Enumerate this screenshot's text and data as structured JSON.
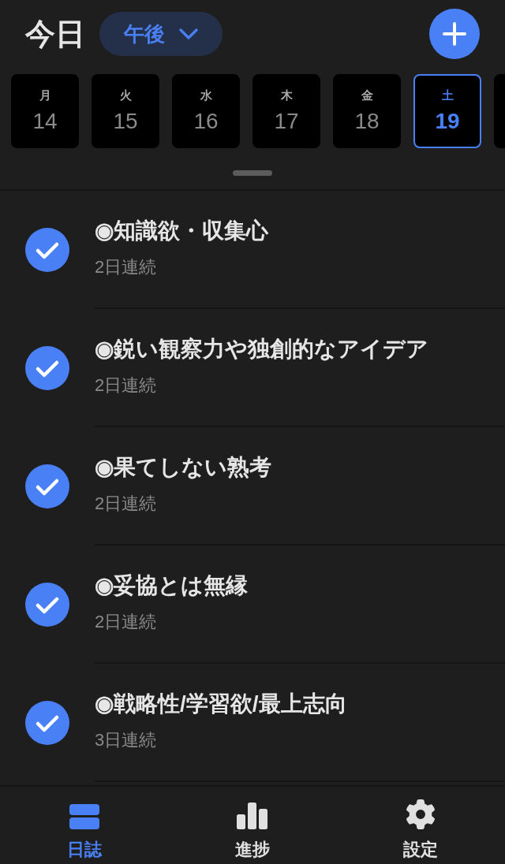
{
  "header": {
    "title": "今日",
    "period": {
      "label": "午後"
    }
  },
  "days": [
    {
      "weekday": "月",
      "date": "14",
      "selected": false
    },
    {
      "weekday": "火",
      "date": "15",
      "selected": false
    },
    {
      "weekday": "水",
      "date": "16",
      "selected": false
    },
    {
      "weekday": "木",
      "date": "17",
      "selected": false
    },
    {
      "weekday": "金",
      "date": "18",
      "selected": false
    },
    {
      "weekday": "土",
      "date": "19",
      "selected": true
    }
  ],
  "items": [
    {
      "title": "◉知識欲・収集心",
      "streak": "2日連続",
      "checked": true
    },
    {
      "title": "◉鋭い観察力や独創的なアイデア",
      "streak": "2日連続",
      "checked": true
    },
    {
      "title": "◉果てしない熟考",
      "streak": "2日連続",
      "checked": true
    },
    {
      "title": "◉妥協とは無縁",
      "streak": "2日連続",
      "checked": true
    },
    {
      "title": "◉戦略性/学習欲/最上志向",
      "streak": "3日連続",
      "checked": true
    }
  ],
  "tab_bar": [
    {
      "label": "日誌",
      "selected": true
    },
    {
      "label": "進捗",
      "selected": false
    },
    {
      "label": "設定",
      "selected": false
    }
  ]
}
